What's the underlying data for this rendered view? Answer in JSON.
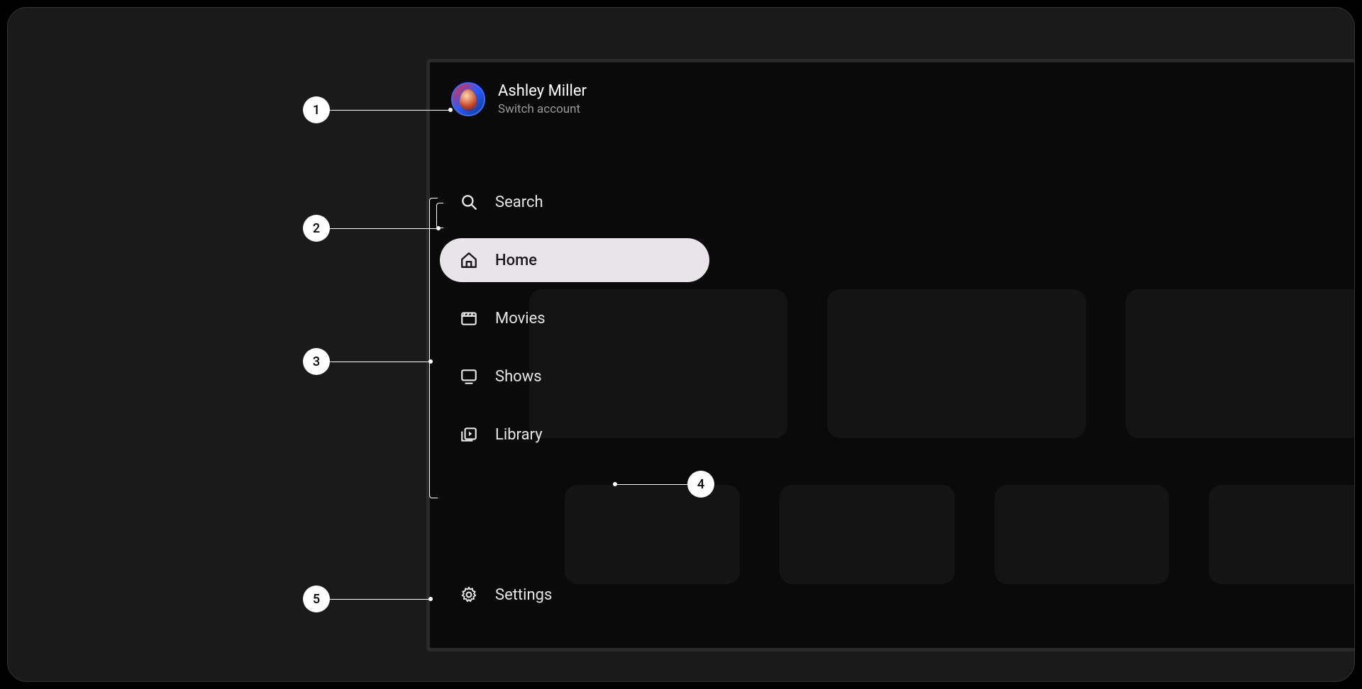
{
  "profile": {
    "name": "Ashley Miller",
    "sub_label": "Switch account"
  },
  "nav": {
    "items": [
      {
        "id": "search",
        "label": "Search",
        "icon": "search-icon",
        "active": false
      },
      {
        "id": "home",
        "label": "Home",
        "icon": "home-icon",
        "active": true
      },
      {
        "id": "movies",
        "label": "Movies",
        "icon": "movies-icon",
        "active": false
      },
      {
        "id": "shows",
        "label": "Shows",
        "icon": "shows-icon",
        "active": false
      },
      {
        "id": "library",
        "label": "Library",
        "icon": "library-icon",
        "active": false
      }
    ],
    "settings_label": "Settings"
  },
  "callouts": {
    "1": "1",
    "2": "2",
    "3": "3",
    "4": "4",
    "5": "5"
  }
}
